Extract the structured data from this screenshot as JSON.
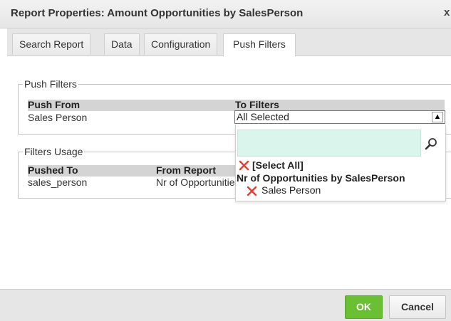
{
  "dialog": {
    "title": "Report Properties: Amount Opportunities by SalesPerson",
    "close_glyph": "x"
  },
  "tabs": [
    {
      "label": "Search Report",
      "active": false
    },
    {
      "label": "Data",
      "active": false
    },
    {
      "label": "Configuration",
      "active": false
    },
    {
      "label": "Push Filters",
      "active": true
    }
  ],
  "push_filters": {
    "legend": "Push Filters",
    "col_push_from": "Push From",
    "col_to_filters": "To Filters",
    "row": {
      "push_from": "Sales Person",
      "to_filters": "All Selected"
    }
  },
  "filters_usage": {
    "legend": "Filters Usage",
    "col_pushed_to": "Pushed To",
    "col_from_report": "From Report",
    "row": {
      "pushed_to": "sales_person",
      "from_report": "Nr of Opportunities by SalesPerson"
    }
  },
  "dropdown": {
    "search_value": "",
    "select_all": "[Select All]",
    "group_label": "Nr of Opportunities by SalesPerson",
    "option": "Sales Person"
  },
  "buttons": {
    "ok": "OK",
    "cancel": "Cancel"
  },
  "colors": {
    "ok_green": "#6bbf33",
    "search_bg": "#d9f5ec",
    "x_red": "#e0453a"
  }
}
